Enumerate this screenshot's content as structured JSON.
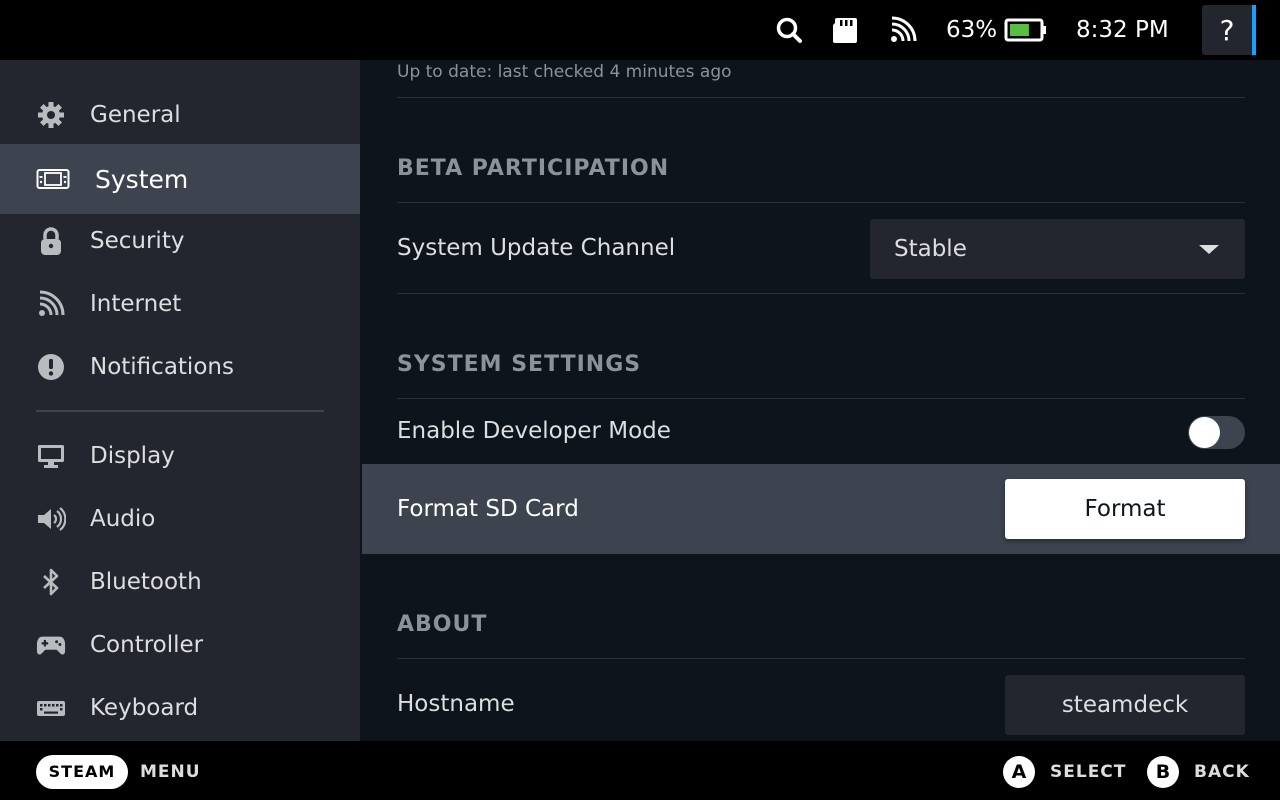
{
  "status_bar": {
    "battery_percent": "63%",
    "battery_level": 0.63,
    "time": "8:32 PM",
    "help_label": "?"
  },
  "sidebar": {
    "items": [
      {
        "label": "General",
        "icon": "gear-icon"
      },
      {
        "label": "System",
        "icon": "steam-deck-icon",
        "active": true
      },
      {
        "label": "Security",
        "icon": "lock-icon"
      },
      {
        "label": "Internet",
        "icon": "wifi-icon"
      },
      {
        "label": "Notifications",
        "icon": "alert-icon"
      },
      {
        "label": "Display",
        "icon": "monitor-icon"
      },
      {
        "label": "Audio",
        "icon": "speaker-icon"
      },
      {
        "label": "Bluetooth",
        "icon": "bluetooth-icon"
      },
      {
        "label": "Controller",
        "icon": "gamepad-icon"
      },
      {
        "label": "Keyboard",
        "icon": "keyboard-icon"
      }
    ]
  },
  "main": {
    "update_status": "Up to date: last checked 4 minutes ago",
    "beta": {
      "title": "BETA PARTICIPATION",
      "channel_label": "System Update Channel",
      "channel_value": "Stable"
    },
    "system_settings": {
      "title": "SYSTEM SETTINGS",
      "developer_mode_label": "Enable Developer Mode",
      "developer_mode_on": false,
      "format_label": "Format SD Card",
      "format_button": "Format"
    },
    "about": {
      "title": "ABOUT",
      "hostname_label": "Hostname",
      "hostname_value": "steamdeck"
    }
  },
  "footer": {
    "steam_label": "STEAM",
    "menu_label": "MENU",
    "a_glyph": "A",
    "select_label": "SELECT",
    "b_glyph": "B",
    "back_label": "BACK"
  },
  "colors": {
    "background": "#0e141b",
    "sidebar": "#23262e",
    "active": "#3d4450",
    "accent": "#1a9fff",
    "battery_green": "#59bf40"
  }
}
